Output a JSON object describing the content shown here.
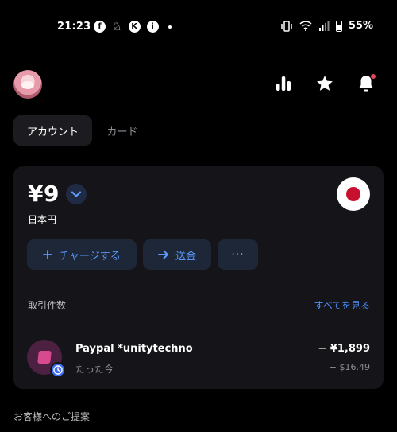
{
  "status_bar": {
    "time": "21:23",
    "left_icons": [
      "facebook-icon",
      "app-icon",
      "k-icon",
      "info-icon"
    ],
    "battery_pct": "55%"
  },
  "header": {
    "icons": [
      "stats-icon",
      "star-icon",
      "bell-icon"
    ],
    "notification_color": "#e8455b"
  },
  "tabs": [
    {
      "label": "アカウント",
      "active": true
    },
    {
      "label": "カード",
      "active": false
    }
  ],
  "account": {
    "balance": "¥9",
    "currency_name": "日本円",
    "actions": {
      "charge": "チャージする",
      "send": "送金",
      "more": "···"
    },
    "transactions_label": "取引件数",
    "see_all": "すべてを見る",
    "transactions": [
      {
        "merchant": "Paypal *unitytechno",
        "time": "たった今",
        "amount": "− ¥1,899",
        "amount_usd": "− $16.49"
      }
    ]
  },
  "suggestions_label": "お客様へのご提案",
  "colors": {
    "accent": "#4e90ff",
    "card_bg": "#151519",
    "flag_red": "#c8102e"
  }
}
